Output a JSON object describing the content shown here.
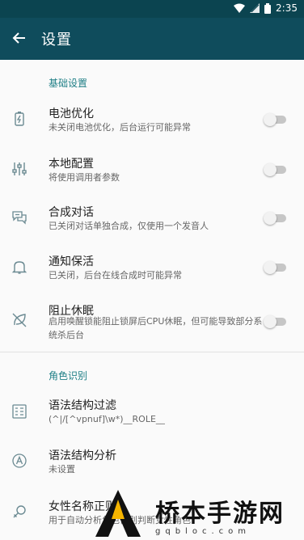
{
  "status": {
    "time": "2:35"
  },
  "appbar": {
    "title": "设置"
  },
  "sections": {
    "basic": "基础设置",
    "role": "角色识别"
  },
  "settings": [
    {
      "title": "电池优化",
      "sub": "未关闭电池优化，后台运行可能异常",
      "icon": "battery-icon",
      "on": false
    },
    {
      "title": "本地配置",
      "sub": "将使用调用者参数",
      "icon": "sliders-icon",
      "on": false
    },
    {
      "title": "合成对话",
      "sub": "已关闭对话单独合成，仅使用一个发音人",
      "icon": "chat-icon",
      "on": false
    },
    {
      "title": "通知保活",
      "sub": "已关闭，后台在线合成时可能异常",
      "icon": "bell-icon",
      "on": false
    },
    {
      "title": "阻止休眠",
      "sub": "启用唤醒锁能阻止锁屏后CPU休眠，但可能导致部分系统杀后台",
      "icon": "leaf-off-icon",
      "on": false
    }
  ],
  "role": [
    {
      "title": "语法结构过滤",
      "sub": "(^|/[^vpnuf]\\w*)__ROLE__",
      "icon": "filter-doc-icon"
    },
    {
      "title": "语法结构分析",
      "sub": "未设置",
      "icon": "text-a-icon"
    },
    {
      "title": "女性名称正则",
      "sub": "用于自动分析角色性别判断女性角色",
      "icon": "female-icon"
    }
  ],
  "watermark": {
    "text": "桥本手游网",
    "url": "gqbloc.com"
  }
}
